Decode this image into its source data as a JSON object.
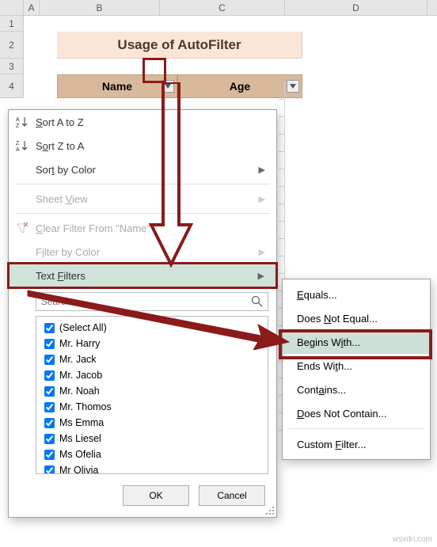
{
  "columns": [
    "A",
    "B",
    "C",
    "D"
  ],
  "row_numbers": [
    "1",
    "2",
    "3",
    "4"
  ],
  "title": "Usage of AutoFilter",
  "headers": {
    "name": "Name",
    "age": "Age"
  },
  "dropdown": {
    "sort_az": "Sort A to Z",
    "sort_za": "Sort Z to A",
    "sort_color": "Sort by Color",
    "sheet_view": "Sheet View",
    "clear_filter": "Clear Filter From \"Name\"",
    "filter_color": "Filter by Color",
    "text_filters": "Text Filters",
    "search_placeholder": "Search",
    "items": [
      "(Select All)",
      "Mr. Harry",
      "Mr. Jack",
      "Mr. Jacob",
      "Mr. Noah",
      "Mr. Thomos",
      "Ms Emma",
      "Ms Liesel",
      "Ms Ofelia",
      "Mr Olivia"
    ],
    "ok": "OK",
    "cancel": "Cancel"
  },
  "submenu": {
    "equals": "Equals...",
    "not_equal": "Does Not Equal...",
    "begins_with": "Begins With...",
    "ends_with": "Ends With...",
    "contains": "Contains...",
    "not_contain": "Does Not Contain...",
    "custom": "Custom Filter..."
  },
  "watermark": "wsxdn.com"
}
